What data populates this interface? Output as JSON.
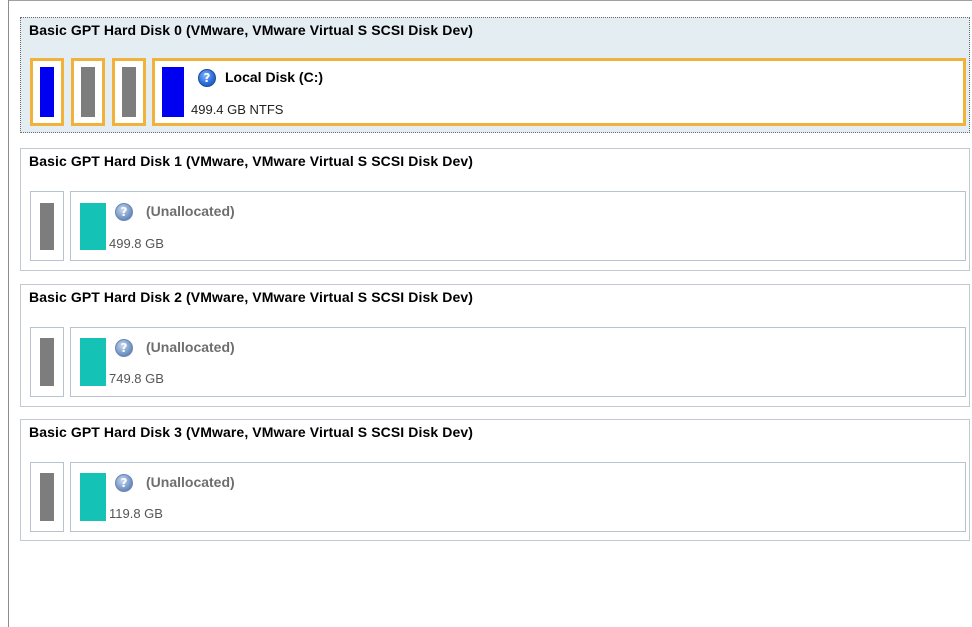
{
  "disks": [
    {
      "title": "Basic GPT Hard Disk 0 (VMware, VMware Virtual S SCSI Disk Dev)",
      "partition": {
        "icon": "help-icon",
        "name": "Local Disk (C:)",
        "size": "499.4 GB NTFS",
        "color": "#0000f0"
      }
    },
    {
      "title": "Basic GPT Hard Disk 1 (VMware, VMware Virtual S SCSI Disk Dev)",
      "partition": {
        "icon": "help-icon",
        "name": "(Unallocated)",
        "size": "499.8 GB",
        "color": "#14c2b6"
      }
    },
    {
      "title": "Basic GPT Hard Disk 2 (VMware, VMware Virtual S SCSI Disk Dev)",
      "partition": {
        "icon": "help-icon",
        "name": "(Unallocated)",
        "size": "749.8 GB",
        "color": "#14c2b6"
      }
    },
    {
      "title": "Basic GPT Hard Disk 3 (VMware, VMware Virtual S SCSI Disk Dev)",
      "partition": {
        "icon": "help-icon",
        "name": "(Unallocated)",
        "size": "119.8 GB",
        "color": "#14c2b6"
      }
    }
  ],
  "colors": {
    "selection": "#f0b23a",
    "selected_bg": "#e3edf2",
    "system_partition": "#7d7d7d"
  }
}
